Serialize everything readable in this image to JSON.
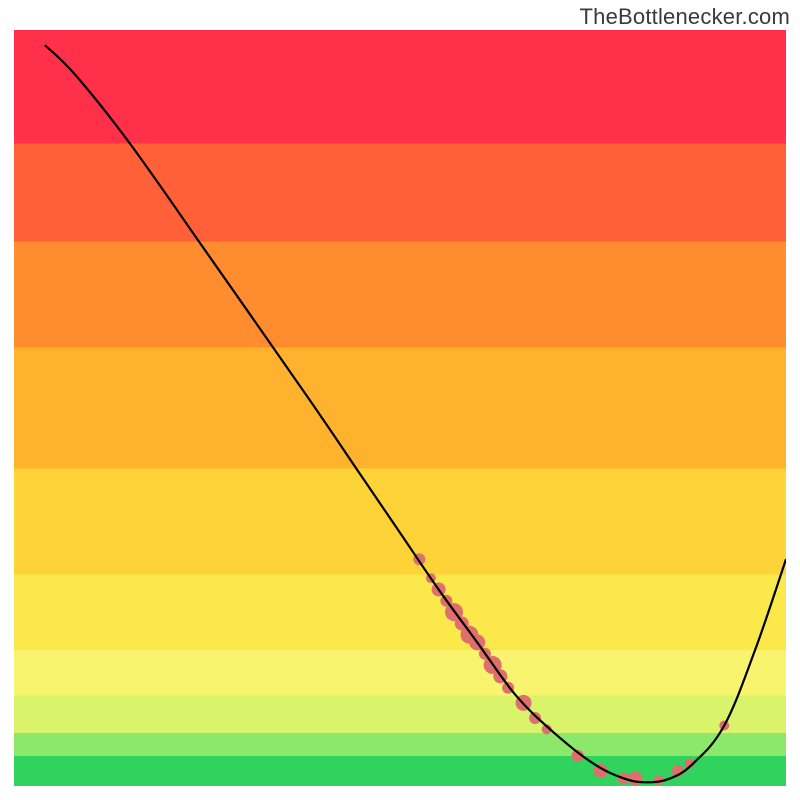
{
  "watermark": "TheBottlenecker.com",
  "chart_data": {
    "type": "line",
    "title": "",
    "xlabel": "",
    "ylabel": "",
    "xlim": [
      0,
      100
    ],
    "ylim": [
      0,
      100
    ],
    "gradient_bands": [
      {
        "y_from": 0.0,
        "y_to": 0.04,
        "color": "#30d35d"
      },
      {
        "y_from": 0.04,
        "y_to": 0.07,
        "color": "#8be86b"
      },
      {
        "y_from": 0.07,
        "y_to": 0.12,
        "color": "#d9f36a"
      },
      {
        "y_from": 0.12,
        "y_to": 0.18,
        "color": "#f8f46d"
      },
      {
        "y_from": 0.18,
        "y_to": 0.28,
        "color": "#fbe84b"
      },
      {
        "y_from": 0.28,
        "y_to": 0.42,
        "color": "#fed338"
      },
      {
        "y_from": 0.42,
        "y_to": 0.58,
        "color": "#ffb22e"
      },
      {
        "y_from": 0.58,
        "y_to": 0.72,
        "color": "#ff8c2f"
      },
      {
        "y_from": 0.72,
        "y_to": 0.85,
        "color": "#ff6038"
      },
      {
        "y_from": 0.85,
        "y_to": 1.0,
        "color": "#ff3049"
      }
    ],
    "series": [
      {
        "name": "bottleneck-curve",
        "x": [
          4.0,
          8.0,
          15.0,
          25.0,
          38.0,
          45.0,
          50.0,
          55.0,
          60.0,
          65.0,
          70.0,
          75.0,
          79.0,
          82.0,
          85.0,
          88.0,
          92.0,
          96.0,
          100.0
        ],
        "y": [
          98.0,
          94.0,
          85.0,
          70.5,
          51.5,
          41.0,
          33.5,
          26.0,
          19.0,
          12.0,
          7.0,
          3.0,
          1.0,
          0.5,
          1.0,
          3.0,
          8.0,
          18.0,
          30.0
        ]
      }
    ],
    "markers": {
      "name": "cluster-dots",
      "color": "#df6f6c",
      "points": [
        {
          "x": 52.5,
          "y": 30.0,
          "r": 6
        },
        {
          "x": 54.0,
          "y": 27.5,
          "r": 5
        },
        {
          "x": 55.0,
          "y": 26.0,
          "r": 7
        },
        {
          "x": 56.0,
          "y": 24.5,
          "r": 6
        },
        {
          "x": 57.0,
          "y": 23.0,
          "r": 9
        },
        {
          "x": 58.0,
          "y": 21.5,
          "r": 7
        },
        {
          "x": 59.0,
          "y": 20.0,
          "r": 9
        },
        {
          "x": 60.0,
          "y": 19.0,
          "r": 8
        },
        {
          "x": 61.0,
          "y": 17.5,
          "r": 6
        },
        {
          "x": 62.0,
          "y": 16.0,
          "r": 9
        },
        {
          "x": 63.0,
          "y": 14.5,
          "r": 7
        },
        {
          "x": 64.0,
          "y": 13.0,
          "r": 6
        },
        {
          "x": 66.0,
          "y": 11.0,
          "r": 8
        },
        {
          "x": 67.5,
          "y": 9.0,
          "r": 6
        },
        {
          "x": 69.0,
          "y": 7.5,
          "r": 5
        },
        {
          "x": 73.0,
          "y": 4.0,
          "r": 6
        },
        {
          "x": 76.0,
          "y": 2.0,
          "r": 7
        },
        {
          "x": 79.0,
          "y": 1.0,
          "r": 6
        },
        {
          "x": 80.5,
          "y": 1.0,
          "r": 7
        },
        {
          "x": 83.5,
          "y": 0.8,
          "r": 5
        },
        {
          "x": 86.0,
          "y": 2.0,
          "r": 6
        },
        {
          "x": 87.5,
          "y": 3.0,
          "r": 5
        },
        {
          "x": 92.0,
          "y": 8.0,
          "r": 5
        }
      ]
    }
  }
}
